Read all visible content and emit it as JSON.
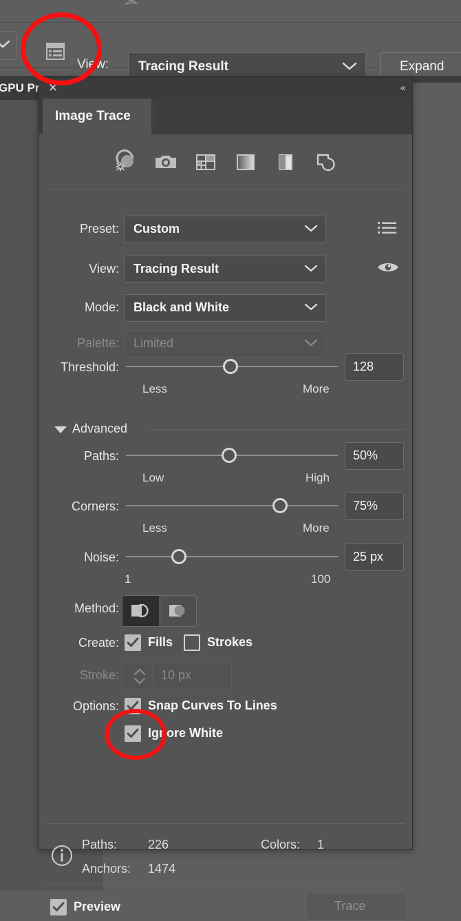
{
  "control_bar": {
    "view_label": "View:",
    "view_value": "Tracing Result",
    "expand_button": "Expand",
    "list_icon": "trace-presets-list-icon",
    "chevron_icon": "chevron-down-icon"
  },
  "behind_panel": {
    "tab_label": "GPU Pr"
  },
  "panel": {
    "close_icon": "close-icon",
    "collapse_icon": "collapse-double-chevron-icon",
    "tab_label": "Image Trace",
    "preset_icons": [
      {
        "name": "auto-color-icon",
        "title": "Auto-Color"
      },
      {
        "name": "high-color-photo-icon",
        "title": "High Color"
      },
      {
        "name": "low-color-icon",
        "title": "Low Color"
      },
      {
        "name": "grayscale-icon",
        "title": "Grayscale"
      },
      {
        "name": "black-and-white-icon",
        "title": "Black and White"
      },
      {
        "name": "outline-icon",
        "title": "Outline"
      }
    ],
    "fields": {
      "preset": {
        "label": "Preset:",
        "value": "Custom",
        "menu_icon": "preset-menu-icon"
      },
      "view": {
        "label": "View:",
        "value": "Tracing Result",
        "eye_icon": "eye-icon"
      },
      "mode": {
        "label": "Mode:",
        "value": "Black and White"
      },
      "palette": {
        "label": "Palette:",
        "value": "Limited",
        "disabled": true
      }
    },
    "threshold": {
      "label": "Threshold:",
      "value": "128",
      "min_label": "Less",
      "max_label": "More",
      "percent": 50
    },
    "advanced": {
      "label": "Advanced",
      "expanded": true,
      "paths": {
        "label": "Paths:",
        "value": "50%",
        "min_label": "Low",
        "max_label": "High",
        "percent": 50
      },
      "corners": {
        "label": "Corners:",
        "value": "75%",
        "min_label": "Less",
        "max_label": "More",
        "percent": 75
      },
      "noise": {
        "label": "Noise:",
        "value": "25 px",
        "min_label": "1",
        "max_label": "100",
        "percent": 25
      },
      "method": {
        "label": "Method:",
        "selected": "abutting",
        "options": [
          {
            "name": "abutting-method-icon",
            "label": "Abutting"
          },
          {
            "name": "overlapping-method-icon",
            "label": "Overlapping"
          }
        ]
      },
      "create": {
        "label": "Create:",
        "fills": {
          "label": "Fills",
          "checked": true
        },
        "strokes": {
          "label": "Strokes",
          "checked": false
        }
      },
      "stroke": {
        "label": "Stroke:",
        "value": "10 px",
        "disabled": true,
        "stepper_icon": "stepper-arrows-icon"
      },
      "options": {
        "label": "Options:",
        "snap_curves": {
          "label": "Snap Curves To Lines",
          "checked": true
        },
        "ignore_white": {
          "label": "Ignore White",
          "checked": true
        }
      }
    },
    "info": {
      "icon": "info-icon",
      "paths_label": "Paths:",
      "paths_value": "226",
      "colors_label": "Colors:",
      "colors_value": "1",
      "anchors_label": "Anchors:",
      "anchors_value": "1474"
    },
    "footer": {
      "preview_label": "Preview",
      "preview_checked": true,
      "trace_button": "Trace",
      "trace_disabled": true
    }
  },
  "annotations": {
    "color": "#f51111",
    "circles": [
      {
        "name": "annotation-circle-list-icon"
      },
      {
        "name": "annotation-circle-ignore-white"
      }
    ]
  }
}
